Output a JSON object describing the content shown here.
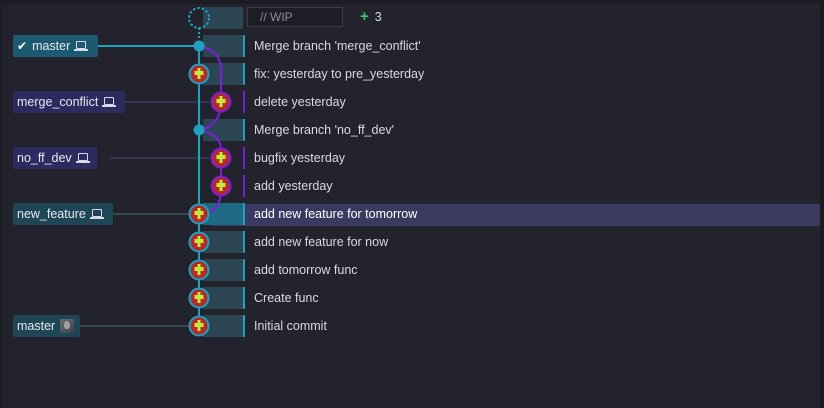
{
  "wip": {
    "placeholder": "// WIP",
    "added_count": "3"
  },
  "colors": {
    "teal": "#21a0c0",
    "purple": "#7a1fd6",
    "selected_row": "#3a3960"
  },
  "branches": [
    {
      "label": "master",
      "icon": "laptop-icon",
      "checked": true
    },
    {
      "label": "merge_conflict",
      "icon": "laptop-icon"
    },
    {
      "label": "no_ff_dev",
      "icon": "laptop-icon"
    },
    {
      "label": "new_feature",
      "icon": "laptop-icon"
    },
    {
      "label": "master",
      "icon": "avatar-icon"
    }
  ],
  "commits": [
    {
      "message": "Merge branch 'merge_conflict'"
    },
    {
      "message": "fix: yesterday to pre_yesterday"
    },
    {
      "message": "delete yesterday"
    },
    {
      "message": "Merge branch 'no_ff_dev'"
    },
    {
      "message": "bugfix yesterday"
    },
    {
      "message": "add yesterday"
    },
    {
      "message": "add new feature for tomorrow",
      "selected": true
    },
    {
      "message": "add new feature for now"
    },
    {
      "message": "add tomorrow func"
    },
    {
      "message": "Create func"
    },
    {
      "message": "Initial commit"
    }
  ]
}
